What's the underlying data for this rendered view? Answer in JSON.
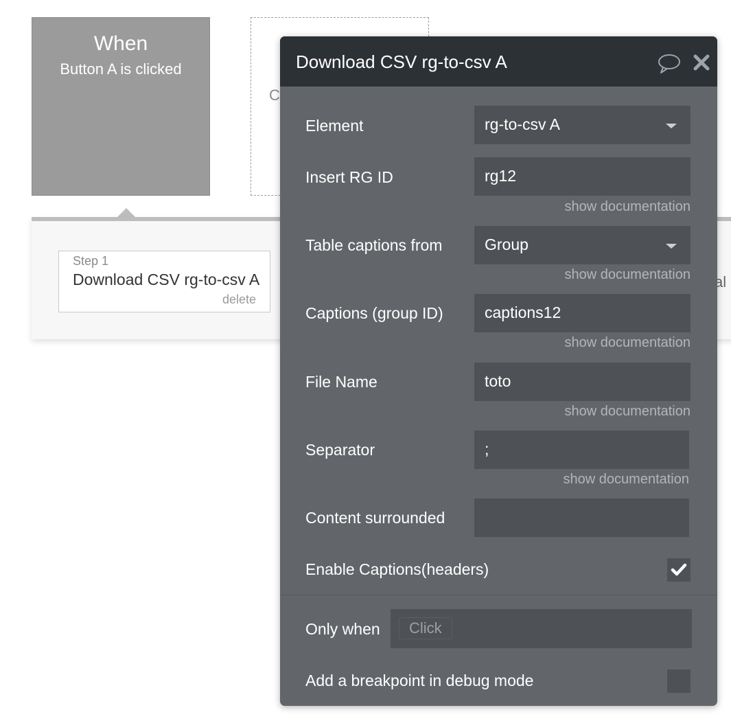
{
  "trigger": {
    "title": "When",
    "event": "Button A is clicked"
  },
  "add_action": {
    "partial_text": "C"
  },
  "steps_panel": {
    "steps": [
      {
        "number": "Step 1",
        "name": "Download CSV rg-to-csv A",
        "delete_label": "delete"
      }
    ],
    "clipped_text": "al"
  },
  "editor": {
    "title": "Download CSV rg-to-csv A",
    "icons": {
      "comment": "comment-icon",
      "close": "close-icon"
    },
    "fields": {
      "element": {
        "label": "Element",
        "value": "rg-to-csv A"
      },
      "rg_id": {
        "label": "Insert RG ID",
        "value": "rg12",
        "doc": "show documentation"
      },
      "captions_from": {
        "label": "Table captions from",
        "value": "Group",
        "doc": "show documentation"
      },
      "captions_group": {
        "label": "Captions (group ID)",
        "value": "captions12",
        "doc": "show documentation"
      },
      "file_name": {
        "label": "File Name",
        "value": "toto",
        "doc": "show documentation"
      },
      "separator": {
        "label": "Separator",
        "value": ";",
        "doc": "show documentation"
      },
      "content_surrounded": {
        "label": "Content surrounded",
        "value": ""
      },
      "enable_captions": {
        "label": "Enable Captions(headers)",
        "checked": true
      }
    },
    "only_when": {
      "label": "Only when",
      "placeholder": "Click"
    },
    "breakpoint": {
      "label": "Add a breakpoint in debug mode",
      "checked": false
    }
  },
  "colors": {
    "editor_bg": "#62666a",
    "editor_header": "#2c3135",
    "field_bg": "#4e5256",
    "trigger_card": "#9b9b9b"
  }
}
